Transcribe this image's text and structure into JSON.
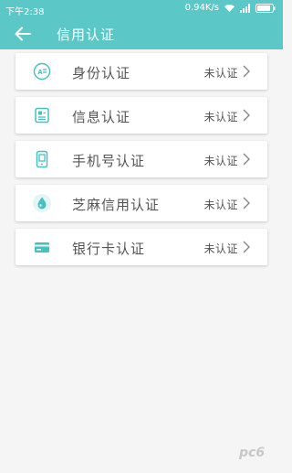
{
  "status_bar": {
    "time": "下午2:38",
    "speed": "0.94K/s",
    "icons": [
      "wifi-icon",
      "signal-icon",
      "battery-icon"
    ]
  },
  "header": {
    "title": "信用认证",
    "back_icon": "back-arrow-icon"
  },
  "items": [
    {
      "label": "身份认证",
      "status": "未认证",
      "icon": "id-card-icon"
    },
    {
      "label": "信息认证",
      "status": "未认证",
      "icon": "info-doc-icon"
    },
    {
      "label": "手机号认证",
      "status": "未认证",
      "icon": "phone-icon"
    },
    {
      "label": "芝麻信用认证",
      "status": "未认证",
      "icon": "sesame-credit-icon"
    },
    {
      "label": "银行卡认证",
      "status": "未认证",
      "icon": "bank-card-icon"
    }
  ],
  "colors": {
    "primary": "#5bc8c7",
    "icon": "#46c1c0",
    "background": "#f5f5f5"
  },
  "watermark": {
    "text": "pc6"
  }
}
